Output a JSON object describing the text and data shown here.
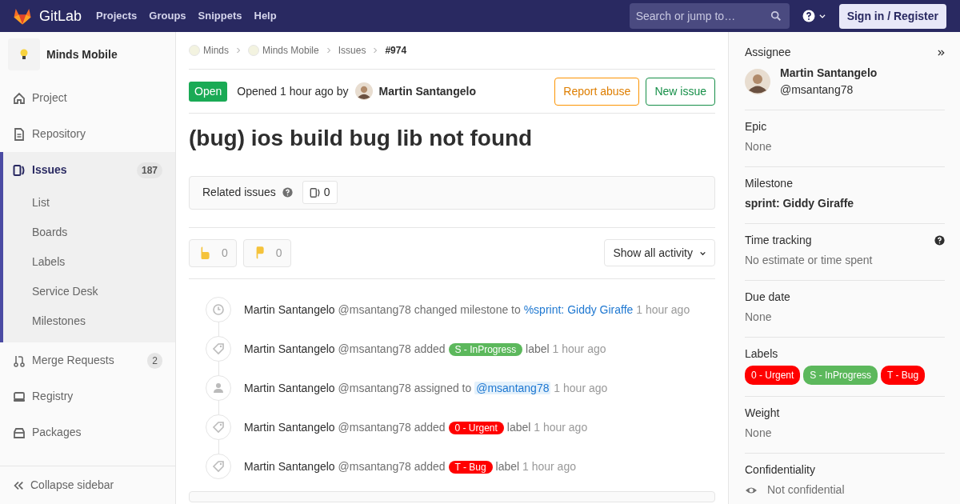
{
  "navbar": {
    "brand": "GitLab",
    "links": [
      "Projects",
      "Groups",
      "Snippets",
      "Help"
    ],
    "search": {
      "placeholder": "Search or jump to…"
    },
    "sign_in": "Sign in / Register"
  },
  "sidebar": {
    "project": "Minds Mobile",
    "items": [
      {
        "label": "Project",
        "kind": "home",
        "selected": false
      },
      {
        "label": "Repository",
        "kind": "doc",
        "selected": false
      },
      {
        "label": "Issues",
        "kind": "issues",
        "count": "187",
        "selected": true,
        "children": [
          {
            "label": "List",
            "selected": false
          },
          {
            "label": "Boards",
            "selected": false
          },
          {
            "label": "Labels",
            "selected": false
          },
          {
            "label": "Service Desk",
            "selected": false
          },
          {
            "label": "Milestones",
            "selected": false
          }
        ]
      },
      {
        "label": "Merge Requests",
        "kind": "merge",
        "count": "2",
        "selected": false
      },
      {
        "label": "Registry",
        "kind": "registry",
        "selected": false
      },
      {
        "label": "Packages",
        "kind": "package",
        "selected": false
      }
    ],
    "collapse": "Collapse sidebar"
  },
  "breadcrumbs": [
    {
      "text": "Minds",
      "kind": "group"
    },
    {
      "text": "Minds Mobile",
      "kind": "project"
    },
    {
      "text": "Issues",
      "kind": "page"
    },
    {
      "text": "#974",
      "kind": "current"
    }
  ],
  "issue": {
    "status": "Open",
    "opened": "Opened 1 hour ago by",
    "author": "Martin Santangelo",
    "buttons": [
      {
        "label": "Report abuse",
        "kind": "warning"
      },
      {
        "label": "New issue",
        "kind": "success"
      }
    ],
    "title": "(bug) ios build bug lib not found"
  },
  "related": {
    "label": "Related issues",
    "count": "0"
  },
  "awards": [
    {
      "kind": "thumbsup",
      "count": "0"
    },
    {
      "kind": "thumbsdown",
      "count": "0"
    }
  ],
  "filter": "Show all activity",
  "activity": [
    {
      "kind": "clock",
      "author": "Martin Santangelo",
      "handle": "@msantang78",
      "action": "changed milestone to",
      "target": {
        "kind": "link",
        "text": "%sprint: Giddy Giraffe"
      },
      "time": "1 hour ago"
    },
    {
      "kind": "tag",
      "author": "Martin Santangelo",
      "handle": "@msantang78",
      "action": "added",
      "target": {
        "kind": "label",
        "text": "S - InProgress",
        "color": "#5cb85c"
      },
      "after": "label",
      "time": "1 hour ago"
    },
    {
      "kind": "person",
      "author": "Martin Santangelo",
      "handle": "@msantang78",
      "action": "assigned to",
      "target": {
        "kind": "mention",
        "text": "@msantang78"
      },
      "time": "1 hour ago"
    },
    {
      "kind": "tag",
      "author": "Martin Santangelo",
      "handle": "@msantang78",
      "action": "added",
      "target": {
        "kind": "label",
        "text": "0 - Urgent",
        "color": "#ff0000"
      },
      "after": "label",
      "time": "1 hour ago"
    },
    {
      "kind": "tag",
      "author": "Martin Santangelo",
      "handle": "@msantang78",
      "action": "added",
      "target": {
        "kind": "label",
        "text": "T - Bug",
        "color": "#ff0000"
      },
      "after": "label",
      "time": "1 hour ago"
    }
  ],
  "right_sidebar": {
    "assignee": {
      "heading": "Assignee",
      "name": "Martin Santangelo",
      "handle": "@msantang78"
    },
    "blocks": [
      {
        "kind": "text",
        "heading": "Epic",
        "value": "None"
      },
      {
        "kind": "bold",
        "heading": "Milestone",
        "value": "sprint: Giddy Giraffe"
      },
      {
        "kind": "help",
        "heading": "Time tracking",
        "value": "No estimate or time spent"
      },
      {
        "kind": "text",
        "heading": "Due date",
        "value": "None"
      },
      {
        "kind": "labels",
        "heading": "Labels",
        "labels": [
          {
            "text": "0 - Urgent",
            "color": "#ff0000"
          },
          {
            "text": "S - InProgress",
            "color": "#5cb85c"
          },
          {
            "text": "T - Bug",
            "color": "#ff0000"
          }
        ]
      },
      {
        "kind": "text",
        "heading": "Weight",
        "value": "None"
      },
      {
        "kind": "eye",
        "heading": "Confidentiality",
        "value": "Not confidential"
      }
    ]
  }
}
